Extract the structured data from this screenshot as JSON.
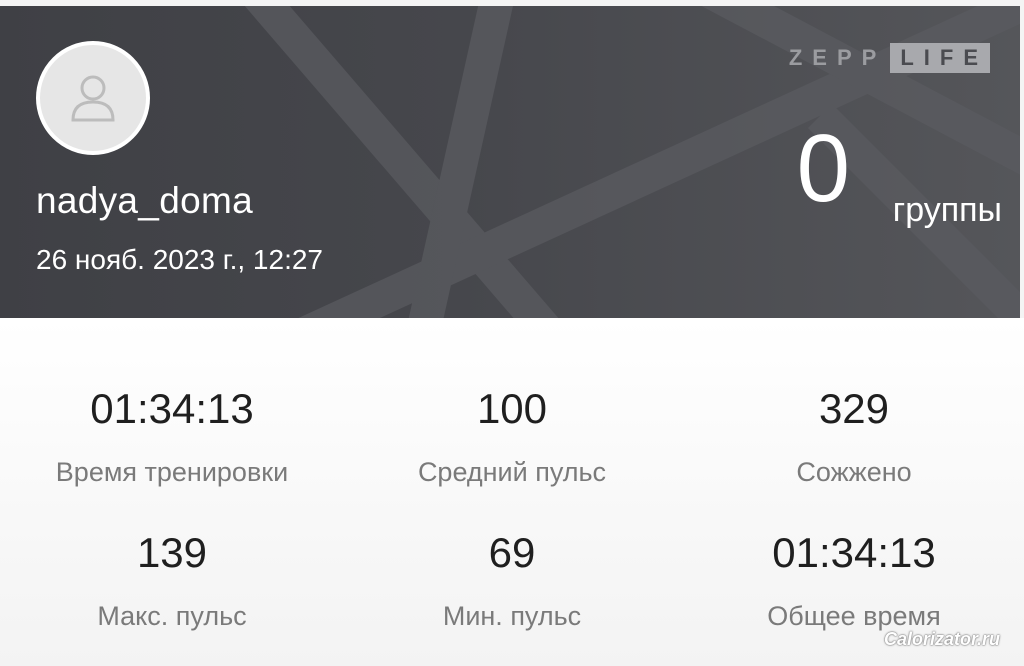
{
  "header": {
    "username": "nadya_doma",
    "datetime": "26 нояб. 2023 г., 12:27",
    "logo": {
      "part1": "ZEPP",
      "part2": "LIFE"
    },
    "group_count": "0",
    "group_label": "группы",
    "avatar_icon": "user-placeholder-icon"
  },
  "stats": [
    {
      "value": "01:34:13",
      "label": "Время тренировки"
    },
    {
      "value": "100",
      "label": "Средний пульс"
    },
    {
      "value": "329",
      "label": "Сожжено"
    },
    {
      "value": "139",
      "label": "Макс. пульс"
    },
    {
      "value": "69",
      "label": "Мин. пульс"
    },
    {
      "value": "01:34:13",
      "label": "Общее время"
    }
  ],
  "watermark": "Calorizator.ru",
  "colors": {
    "header_bg": "#46474c",
    "text_primary": "#1f1f1f",
    "text_secondary": "#7a7a7a"
  }
}
